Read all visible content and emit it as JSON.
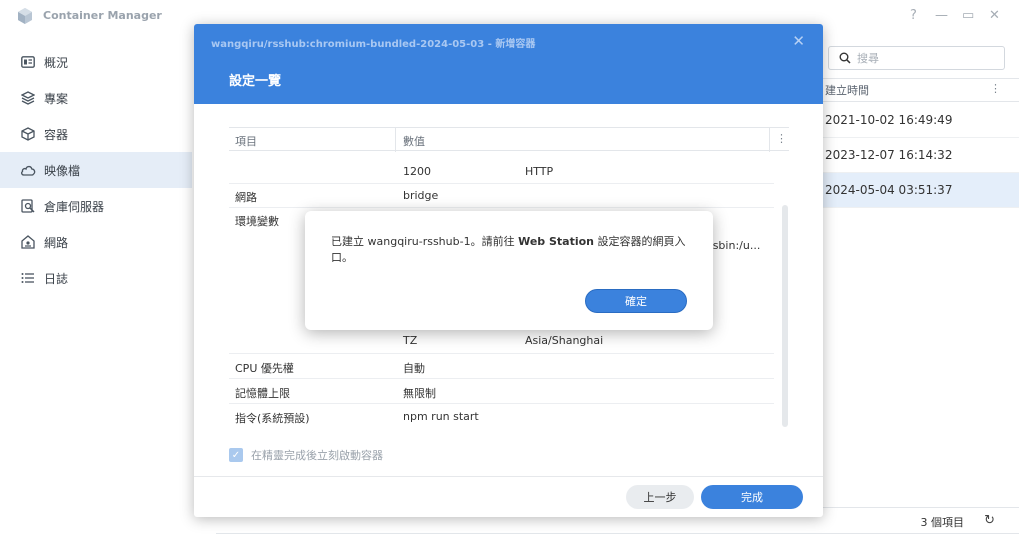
{
  "app": {
    "title": "Container Manager",
    "window_controls": {
      "help": "?",
      "minimize": "—",
      "maximize": "▭",
      "close": "✕"
    }
  },
  "sidebar": {
    "items": [
      {
        "label": "概況",
        "icon": "overview-icon"
      },
      {
        "label": "專案",
        "icon": "project-icon"
      },
      {
        "label": "容器",
        "icon": "container-icon"
      },
      {
        "label": "映像檔",
        "icon": "image-icon",
        "active": true
      },
      {
        "label": "倉庫伺服器",
        "icon": "registry-icon"
      },
      {
        "label": "網路",
        "icon": "network-icon"
      },
      {
        "label": "日誌",
        "icon": "log-icon"
      }
    ]
  },
  "images": {
    "search_placeholder": "搜尋",
    "column_created": "建立時間",
    "rows": [
      {
        "created": "2021-10-02 16:49:49"
      },
      {
        "created": "2023-12-07 16:14:32"
      },
      {
        "created": "2024-05-04 03:51:37",
        "selected": true
      }
    ],
    "item_count": "3 個項目"
  },
  "wizard": {
    "caption": "wangqiru/rsshub:chromium-bundled-2024-05-03 - 新增容器",
    "title": "設定一覽",
    "columns": {
      "item": "項目",
      "value": "數值"
    },
    "rows": {
      "port_partial": {
        "value": "1200",
        "value2": "HTTP"
      },
      "network": {
        "key": "網路",
        "value": "bridge"
      },
      "env": {
        "key": "環境變數",
        "value_partial": "/sbin:/u..."
      },
      "tz": {
        "value": "TZ",
        "value2": "Asia/Shanghai"
      },
      "cpu": {
        "key": "CPU 優先權",
        "value": "自動"
      },
      "mem": {
        "key": "記憶體上限",
        "value": "無限制"
      },
      "cmd": {
        "key": "指令(系統預設)",
        "value": "npm run start"
      }
    },
    "autostart_label": "在精靈完成後立刻啟動容器",
    "autostart_checked": true,
    "prev_label": "上一步",
    "done_label": "完成"
  },
  "alert": {
    "msg_prefix": "已建立 wangqiru-rsshub-1。請前往 ",
    "msg_bold": "Web Station",
    "msg_suffix": " 設定容器的網頁入口。",
    "ok_label": "確定"
  },
  "colors": {
    "accent": "#3b82dd",
    "selected_row": "#e4eefa"
  }
}
